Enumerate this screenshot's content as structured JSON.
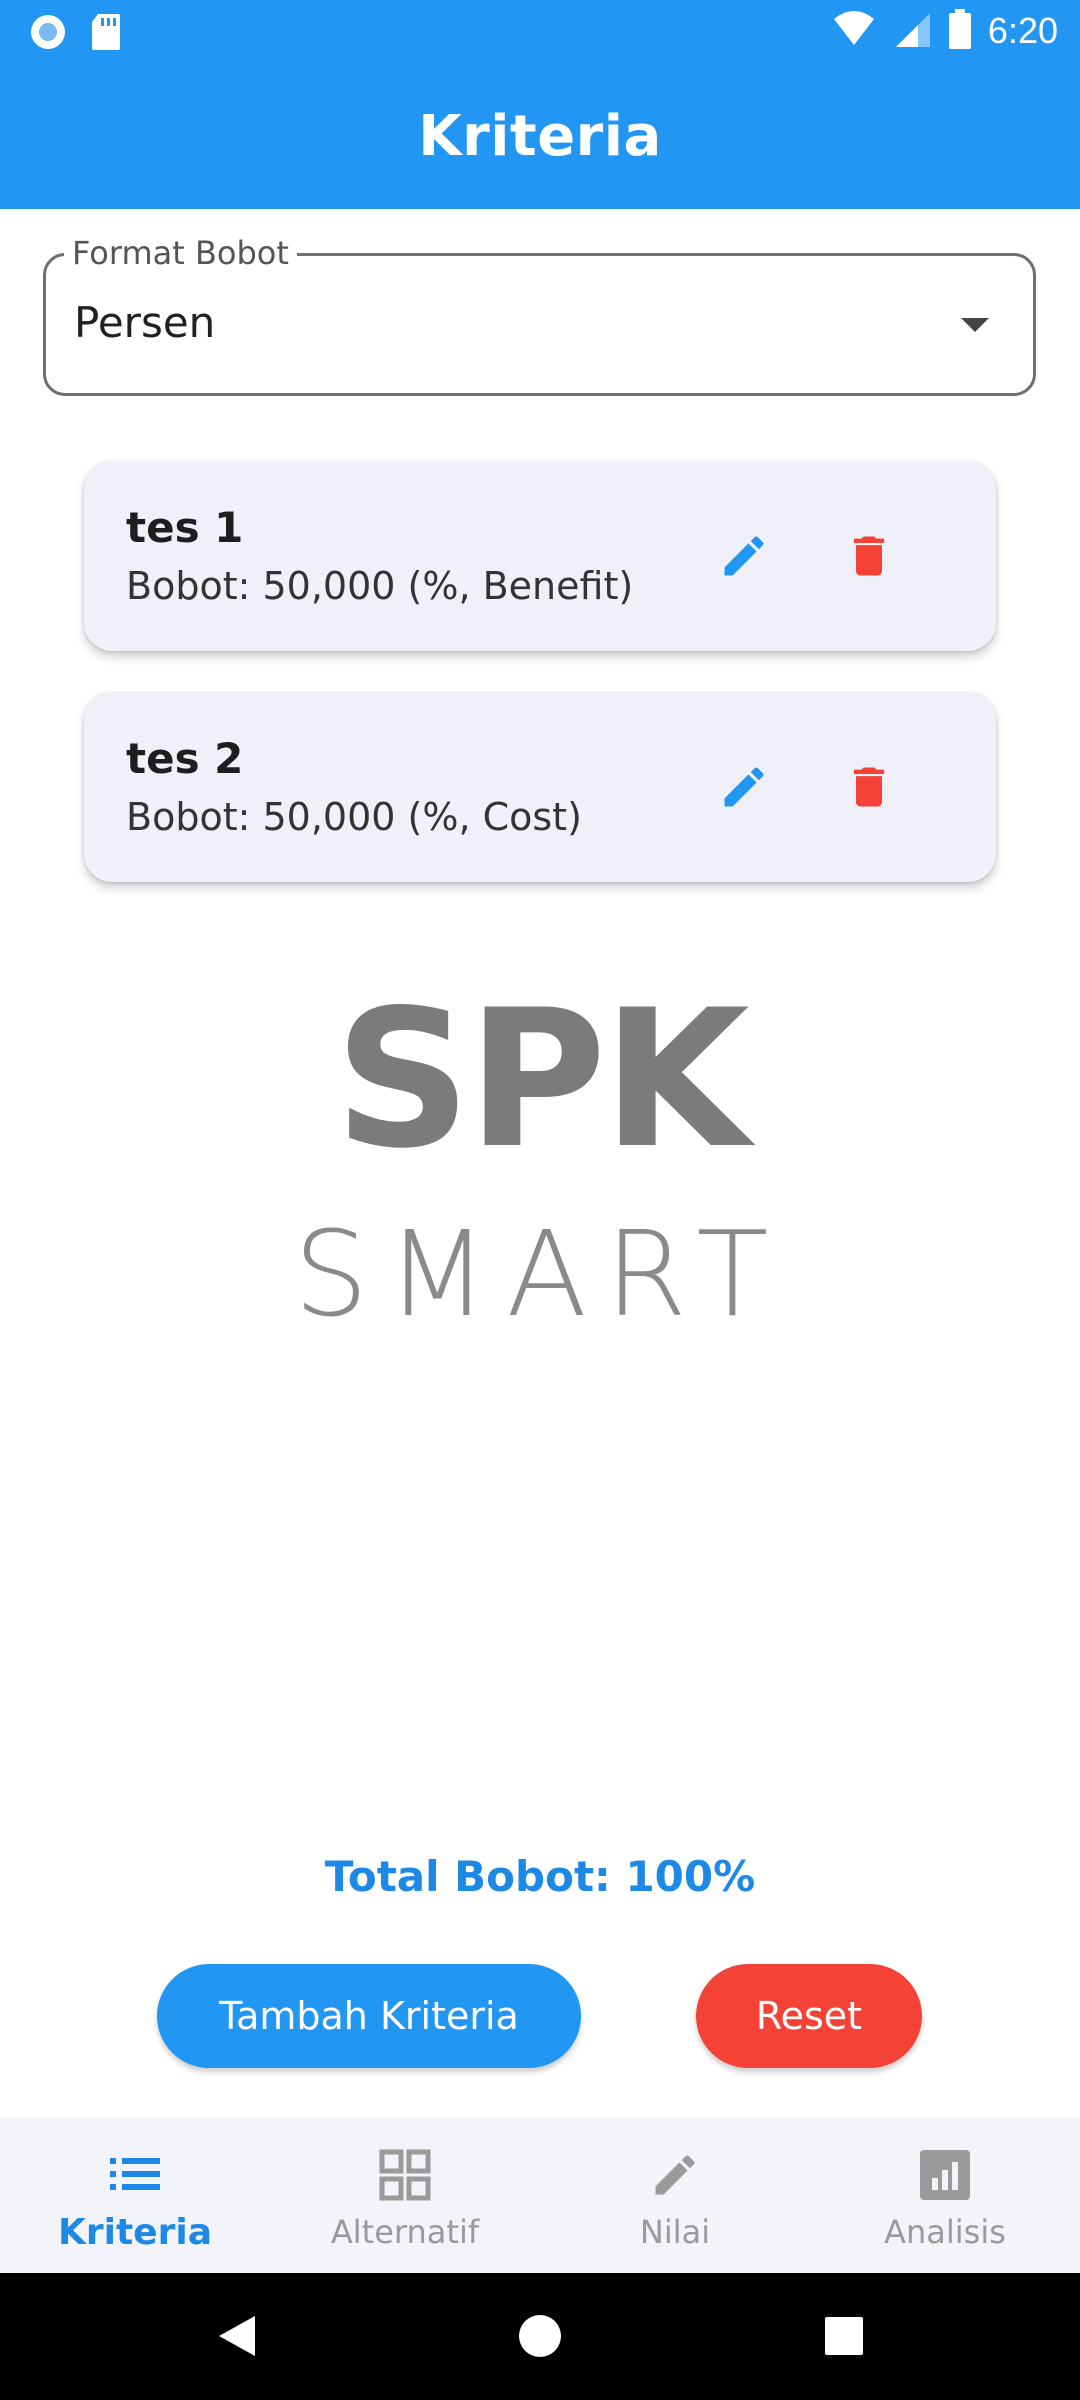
{
  "status_bar": {
    "time": "6:20",
    "icons": [
      "radio-icon",
      "sd-card-icon",
      "wifi-icon",
      "signal-icon",
      "battery-icon"
    ]
  },
  "app_bar": {
    "title": "Kriteria",
    "color": "#2196f3"
  },
  "format_bobot": {
    "label": "Format Bobot",
    "value": "Persen"
  },
  "criteria": [
    {
      "name": "tes 1",
      "detail": "Bobot: 50,000 (%, Benefit)"
    },
    {
      "name": "tes 2",
      "detail": "Bobot: 50,000 (%, Cost)"
    }
  ],
  "logo": {
    "line1": "SPK",
    "line2": "SMART"
  },
  "total": "Total Bobot: 100%",
  "actions": {
    "add_label": "Tambah Kriteria",
    "reset_label": "Reset",
    "add_color": "#2196f3",
    "reset_color": "#f44336"
  },
  "bottom_nav": {
    "items": [
      {
        "label": "Kriteria",
        "icon": "list-icon",
        "active": true
      },
      {
        "label": "Alternatif",
        "icon": "grid-icon",
        "active": false
      },
      {
        "label": "Nilai",
        "icon": "pencil-icon",
        "active": false
      },
      {
        "label": "Analisis",
        "icon": "bar-chart-icon",
        "active": false
      }
    ]
  },
  "system_nav": {
    "icons": [
      "back-icon",
      "home-icon",
      "recents-icon"
    ]
  }
}
